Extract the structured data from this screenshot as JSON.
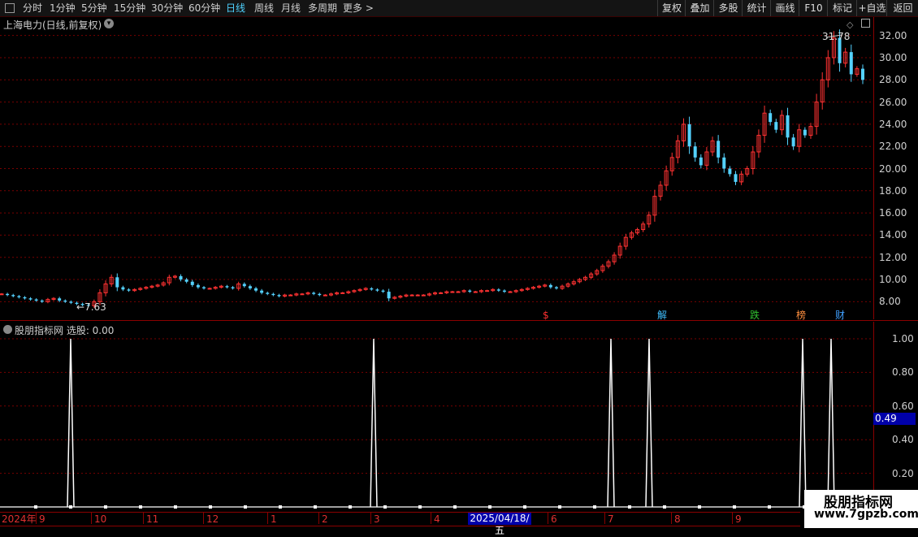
{
  "toolbar": {
    "periods": [
      "分时",
      "1分钟",
      "5分钟",
      "15分钟",
      "30分钟",
      "60分钟",
      "日线",
      "周线",
      "月线",
      "多周期",
      "更多 >"
    ],
    "active_period": "日线",
    "right_buttons": [
      "复权",
      "叠加",
      "多股",
      "统计",
      "画线",
      "F10",
      "标记",
      "+自选",
      "返回"
    ]
  },
  "chart": {
    "title": "上海电力(日线,前复权)",
    "high_label": "31.78",
    "low_label": "7.63",
    "price_ticks": [
      "32.00",
      "30.00",
      "28.00",
      "26.00",
      "24.00",
      "22.00",
      "20.00",
      "18.00",
      "16.00",
      "14.00",
      "12.00",
      "10.00",
      "8.00"
    ],
    "badges": [
      {
        "text": "$",
        "color": "#ff3030"
      },
      {
        "text": "解",
        "color": "#40c0ff"
      },
      {
        "text": "跌",
        "color": "#30c030"
      },
      {
        "text": "榜",
        "color": "#ff9040"
      },
      {
        "text": "财",
        "color": "#40a0ff"
      }
    ]
  },
  "indicator": {
    "title": "股朋指标网  选股: 0.00",
    "ticks": [
      "1.00",
      "0.80",
      "0.60",
      "0.40",
      "0.20"
    ],
    "cursor_value": "0.49"
  },
  "date_axis": {
    "labels": [
      "2024年",
      "9",
      "10",
      "11",
      "12",
      "1",
      "2",
      "3",
      "4",
      "6",
      "7",
      "8",
      "9"
    ],
    "cursor_date": "2025/04/18/五"
  },
  "watermark": {
    "name": "股朋指标网",
    "url": "www.7gpzb.com"
  },
  "colors": {
    "up": "#ff3232",
    "down": "#54d2ff",
    "grid": "#7a0000",
    "axis": "#8b0000"
  },
  "chart_data": {
    "type": "candlestick",
    "series_closes": [
      8.7,
      8.6,
      8.5,
      8.4,
      8.3,
      8.2,
      8.1,
      8.0,
      8.2,
      8.3,
      8.1,
      8.0,
      7.9,
      7.8,
      7.7,
      7.63,
      8.0,
      8.8,
      9.6,
      10.2,
      9.3,
      9.1,
      9.0,
      9.1,
      9.2,
      9.3,
      9.4,
      9.5,
      9.7,
      10.2,
      10.3,
      10.0,
      9.8,
      9.5,
      9.3,
      9.2,
      9.2,
      9.3,
      9.4,
      9.3,
      9.2,
      9.6,
      9.4,
      9.2,
      9.0,
      8.8,
      8.7,
      8.6,
      8.5,
      8.6,
      8.6,
      8.7,
      8.7,
      8.8,
      8.7,
      8.6,
      8.6,
      8.7,
      8.8,
      8.8,
      8.9,
      9.0,
      9.1,
      9.2,
      9.1,
      9.0,
      8.9,
      8.3,
      8.4,
      8.5,
      8.6,
      8.6,
      8.6,
      8.6,
      8.7,
      8.8,
      8.8,
      8.9,
      8.9,
      8.9,
      9.0,
      8.9,
      8.9,
      9.0,
      9.0,
      9.1,
      9.0,
      8.9,
      8.9,
      9.0,
      9.1,
      9.2,
      9.3,
      9.4,
      9.5,
      9.3,
      9.2,
      9.4,
      9.6,
      9.8,
      10.0,
      10.2,
      10.5,
      10.8,
      11.2,
      11.6,
      12.2,
      13.0,
      13.8,
      14.2,
      14.5,
      15.0,
      15.8,
      17.5,
      18.5,
      19.8,
      21.0,
      22.5,
      24.0,
      22.0,
      21.0,
      20.3,
      21.5,
      22.5,
      21.0,
      20.0,
      19.5,
      18.8,
      19.5,
      20.0,
      21.5,
      23.0,
      25.0,
      24.2,
      23.5,
      24.8,
      22.8,
      22.0,
      23.5,
      23.0,
      23.8,
      26.0,
      28.0,
      30.0,
      31.78,
      29.5,
      30.5,
      28.5,
      29.0,
      28.0
    ],
    "price_ylim": [
      7.0,
      33.0
    ],
    "indicator_signal_x": [
      "2024-09",
      "2025-03",
      "2025-07a",
      "2025-07b",
      "2025-09a",
      "2025-09b"
    ],
    "indicator_ylim": [
      0,
      1.05
    ]
  }
}
